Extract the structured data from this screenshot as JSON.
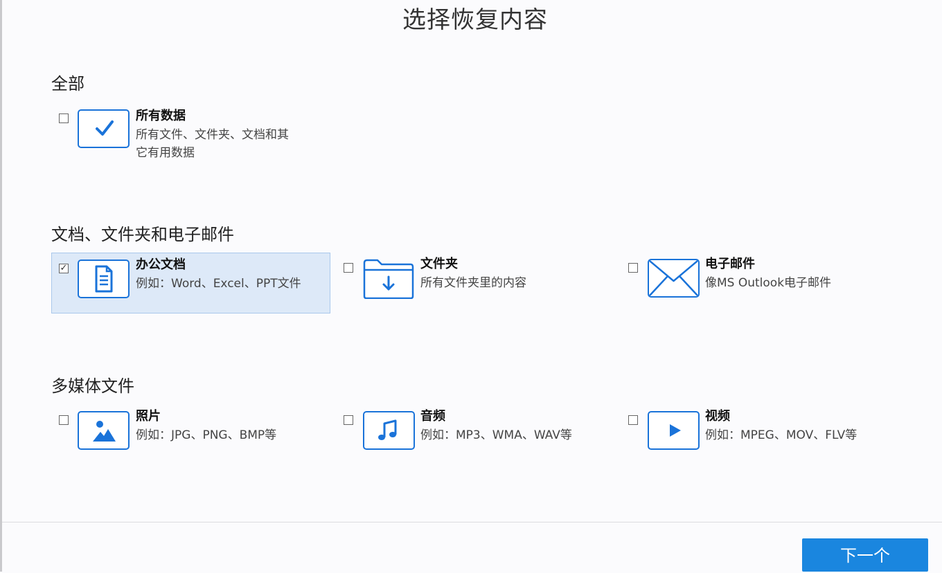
{
  "title": "选择恢复内容",
  "sections": [
    {
      "label": "全部",
      "options": [
        {
          "title": "所有数据",
          "desc_line1": "所有文件、文件夹、文档和其",
          "desc_line2": "它有用数据",
          "icon": "checkmark-icon",
          "checked": false
        }
      ]
    },
    {
      "label": "文档、文件夹和电子邮件",
      "options": [
        {
          "title": "办公文档",
          "desc": "例如：Word、Excel、PPT文件",
          "icon": "document-icon",
          "checked": true,
          "check_mark": "✓"
        },
        {
          "title": "文件夹",
          "desc": "所有文件夹里的内容",
          "icon": "folder-download-icon",
          "checked": false
        },
        {
          "title": "电子邮件",
          "desc": "像MS Outlook电子邮件",
          "icon": "envelope-icon",
          "checked": false
        }
      ]
    },
    {
      "label": "多媒体文件",
      "options": [
        {
          "title": "照片",
          "desc": "例如：JPG、PNG、BMP等",
          "icon": "image-icon",
          "checked": false
        },
        {
          "title": "音频",
          "desc": "例如：MP3、WMA、WAV等",
          "icon": "music-note-icon",
          "checked": false
        },
        {
          "title": "视频",
          "desc": "例如：MPEG、MOV、FLV等",
          "icon": "play-icon",
          "checked": false
        }
      ]
    }
  ],
  "footer": {
    "next_label": "下一个"
  },
  "colors": {
    "accent": "#1a73d9",
    "button": "#1a86df",
    "selected_bg": "#dde9f8"
  }
}
